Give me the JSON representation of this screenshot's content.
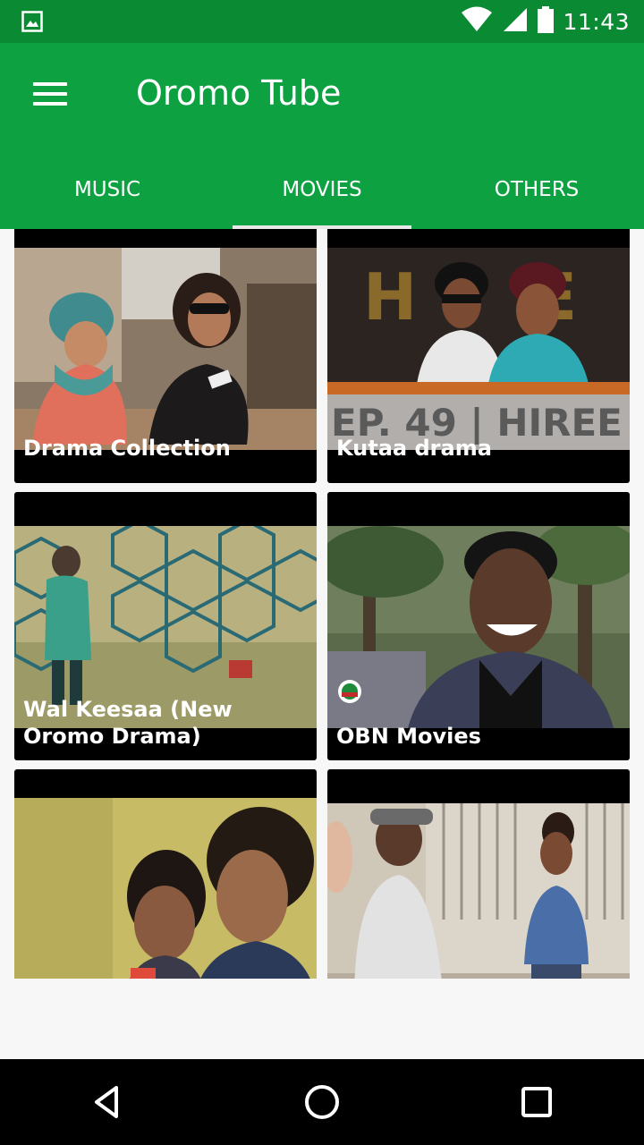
{
  "status_bar": {
    "time": "11:43",
    "icons": [
      "image-notification-icon",
      "wifi-icon",
      "signal-icon",
      "battery-icon"
    ]
  },
  "app_bar": {
    "title": "Oromo Tube",
    "menu_icon": "hamburger-menu-icon",
    "background": "#0ea142"
  },
  "tabs": [
    {
      "label": "MUSIC",
      "active": false
    },
    {
      "label": "MOVIES",
      "active": true
    },
    {
      "label": "OTHERS",
      "active": false
    }
  ],
  "cards": [
    {
      "title": "Drama Collection",
      "thumbnail": "two-women-at-table"
    },
    {
      "title": "Kutaa drama",
      "thumbnail": "hiree-episode-49-poster",
      "thumb_text": "EP. 49 | HIREE"
    },
    {
      "title": "Wal Keesaa (New Oromo Drama)",
      "thumbnail": "woman-by-hexagon-fence"
    },
    {
      "title": "OBN Movies",
      "thumbnail": "smiling-man-outdoors"
    },
    {
      "title": "",
      "thumbnail": "two-women-portrait"
    },
    {
      "title": "",
      "thumbnail": "man-and-woman-by-gate"
    }
  ],
  "nav_bar": {
    "buttons": [
      "back-icon",
      "home-icon",
      "recents-icon"
    ]
  }
}
